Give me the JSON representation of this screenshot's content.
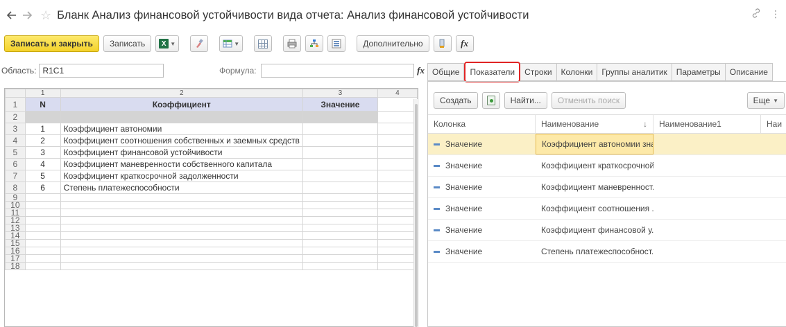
{
  "window": {
    "title": "Бланк Анализ финансовой устойчивости вида отчета: Анализ финансовой устойчивости",
    "back_icon": "arrow-left",
    "forward_icon": "arrow-right",
    "star_icon": "star",
    "link_icon": "link",
    "menu_icon": "more-vertical"
  },
  "toolbar": {
    "save_close_label": "Записать и закрыть",
    "save_label": "Записать",
    "additional_label": "Дополнительно",
    "excel_glyph": "X",
    "fx_glyph": "fx"
  },
  "area_row": {
    "area_label": "Область:",
    "area_value": "R1C1",
    "formula_label": "Формула:",
    "formula_value": ""
  },
  "sheet": {
    "col_headers": [
      "1",
      "2",
      "3",
      "4"
    ],
    "header": {
      "n": "N",
      "coef": "Коэффициент",
      "value": "Значение"
    },
    "rows": [
      {
        "num": "1",
        "n": "1",
        "name": "Коэффициент автономии"
      },
      {
        "num": "2",
        "n": "2",
        "name": "Коэффициент соотношения собственных и заемных средств"
      },
      {
        "num": "3",
        "n": "3",
        "name": "Коэффициент финансовой устойчивости"
      },
      {
        "num": "4",
        "n": "4",
        "name": "Коэффициент маневренности собственного капитала"
      },
      {
        "num": "5",
        "n": "5",
        "name": "Коэффициент краткосрочной задолженности"
      },
      {
        "num": "6",
        "n": "6",
        "name": "Степень платежеспособности"
      }
    ],
    "row_numbers": [
      "1",
      "2",
      "3",
      "4",
      "5",
      "6",
      "7",
      "8",
      "9",
      "10",
      "11",
      "12",
      "13",
      "14",
      "15",
      "16",
      "17",
      "18"
    ]
  },
  "tabs": [
    "Общие",
    "Показатели",
    "Строки",
    "Колонки",
    "Группы аналитик",
    "Параметры",
    "Описание"
  ],
  "active_tab": "Показатели",
  "right_toolbar": {
    "create_label": "Создать",
    "find_label": "Найти...",
    "cancel_search_label": "Отменить поиск",
    "more_label": "Еще"
  },
  "list": {
    "columns": [
      "Колонка",
      "Наименование",
      "Наименование1",
      "Наи"
    ],
    "rows": [
      {
        "column": "Значение",
        "name": "Коэффициент автономии зна..."
      },
      {
        "column": "Значение",
        "name": "Коэффициент краткосрочной..."
      },
      {
        "column": "Значение",
        "name": "Коэффициент маневренност..."
      },
      {
        "column": "Значение",
        "name": "Коэффициент соотношения ..."
      },
      {
        "column": "Значение",
        "name": "Коэффициент финансовой у..."
      },
      {
        "column": "Значение",
        "name": "Степень платежеспособност..."
      }
    ]
  },
  "colors": {
    "primary_button": "#f4d22b",
    "active_tab_outline": "#e02424",
    "selected_row": "#fbf0c6",
    "header_cell": "#d9dcf0"
  }
}
